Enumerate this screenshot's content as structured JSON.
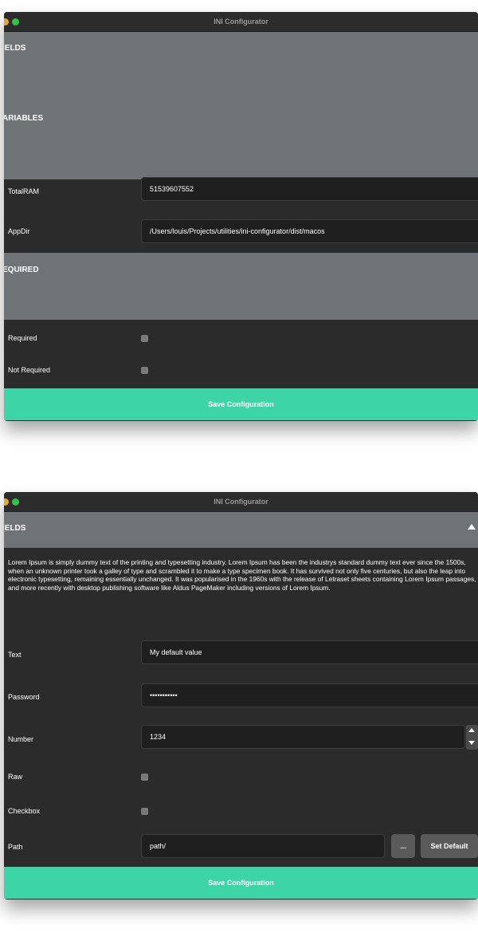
{
  "window1": {
    "title": "INI Configurator",
    "sections": {
      "fields": "IELDS",
      "variables": "ARIABLES",
      "required": "EQUIRED"
    },
    "totalram": {
      "label": "TotalRAM",
      "value": "51539607552"
    },
    "appdir": {
      "label": "AppDir",
      "value": "/Users/louis/Projects/utilities/ini-configurator/dist/macos"
    },
    "required_label": "Required",
    "not_required_label": "Not Required",
    "save_label": "Save Configuration"
  },
  "window2": {
    "title": "INI Configurator",
    "fields_title": "IELDS",
    "description": "Lorem Ipsum is simply dummy text of the printing and typesetting industry. Lorem Ipsum has been the industrys standard dummy text ever since the 1500s, when an unknown printer took a galley of type and scrambled it to make a type specimen book. It has survived not only five centuries, but also the leap into electronic typesetting, remaining essentially unchanged. It was popularised in the 1960s with the release of Letraset sheets containing Lorem Ipsum passages, and more recently with desktop publishing software like Aldus PageMaker including versions of Lorem Ipsum.",
    "text": {
      "label": "Text",
      "value": "My default value"
    },
    "password": {
      "label": "Password",
      "value": "•••••••••••"
    },
    "number": {
      "label": "Number",
      "value": "1234"
    },
    "raw_label": "Raw",
    "checkbox_label": "Checkbox",
    "path": {
      "label": "Path",
      "value": "path/"
    },
    "browse_label": "...",
    "set_default_label": "Set Default",
    "save_label": "Save Configuration"
  },
  "colors": {
    "accent": "#3ed5a6",
    "section": "#6f7376",
    "background": "#2b2b2b",
    "input": "#1f1f1f"
  },
  "icons": [
    "close-icon",
    "maximize-icon",
    "collapse-arrow-icon",
    "stepper-up-icon",
    "stepper-down-icon"
  ]
}
